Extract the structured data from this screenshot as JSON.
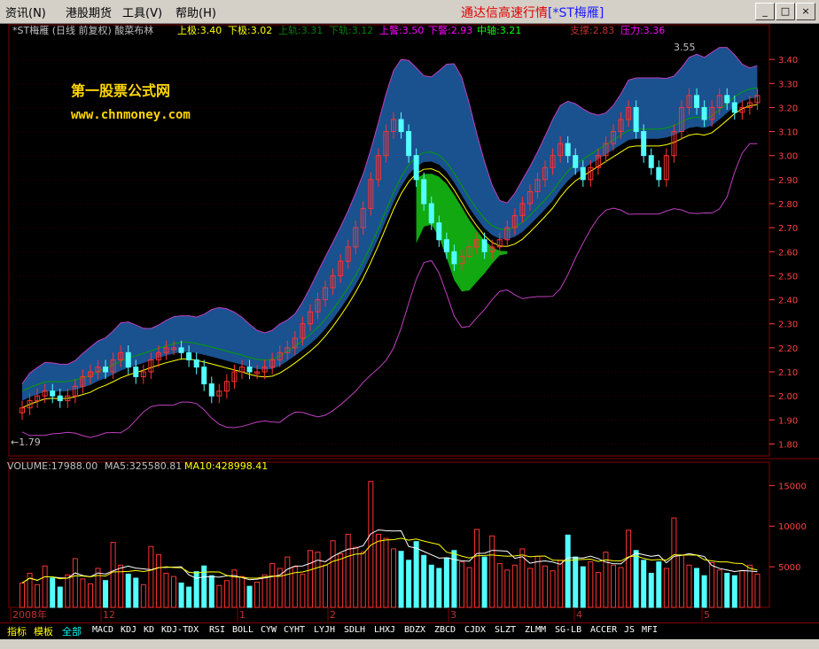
{
  "menu": {
    "items": [
      "资讯(N)",
      "港股期货",
      "工具(V)",
      "帮助(H)"
    ],
    "app_title": "通达信高速行情",
    "window_title": "[*ST梅雁]",
    "win_buttons": [
      "_",
      "□",
      "×"
    ]
  },
  "header": {
    "stock_name": "*ST梅雁 (日线 前复权) 酸菜布林",
    "indicators": [
      {
        "label": "上极:3.40",
        "color": "#ffff00"
      },
      {
        "label": "下极:3.02",
        "color": "#ffff00"
      },
      {
        "label": "上轨:3.31",
        "color": "#008000"
      },
      {
        "label": "下轨:3.12",
        "color": "#008000"
      },
      {
        "label": "上警:3.50",
        "color": "#ff00ff"
      },
      {
        "label": "下警:2.93",
        "color": "#ff00ff"
      },
      {
        "label": "中轴:3.21",
        "color": "#00ff00"
      },
      {
        "label": "支撑:2.83",
        "color": "#c03030"
      },
      {
        "label": "压力:3.36",
        "color": "#ff00ff"
      }
    ]
  },
  "watermark": {
    "line1": "第一股票公式网",
    "line2": "www.chnmoney.com"
  },
  "annotations": {
    "high": "3.55",
    "low": "←1.79"
  },
  "price_axis": [
    "3.40",
    "3.30",
    "3.20",
    "3.10",
    "3.00",
    "2.90",
    "2.80",
    "2.70",
    "2.60",
    "2.50",
    "2.40",
    "2.30",
    "2.20",
    "2.10",
    "2.00",
    "1.90",
    "1.80"
  ],
  "volume_header": {
    "vol": "VOLUME:17988.00",
    "ma5": "MA5:325580.81",
    "ma10": "MA10:428998.41"
  },
  "volume_axis": [
    "15000",
    "10000",
    "5000"
  ],
  "date_axis": [
    "2008年",
    "12",
    "1",
    "2",
    "3",
    "4",
    "5"
  ],
  "tabs": {
    "categories": [
      "指标",
      "模板",
      "全部"
    ],
    "items": [
      "MACD",
      "KDJ",
      "KD",
      "KDJ-TDX",
      "RSI",
      "BOLL",
      "CYW",
      "CYHT",
      "LYJH",
      "SDLH",
      "LHXJ",
      "BDZX",
      "ZBCD",
      "CJDX",
      "SLZT",
      "ZLMM",
      "SG-LB",
      "ACCER",
      "JS",
      "MFI"
    ]
  },
  "chart_data": {
    "type": "candlestick",
    "title": "*ST梅雁 (日线 前复权) 酸菜布林",
    "price_range": [
      1.75,
      3.5
    ],
    "volume_range": [
      0,
      17000
    ],
    "x_labels": [
      "2008年",
      "12",
      "1",
      "2",
      "3",
      "4",
      "5"
    ],
    "high_mark": 3.55,
    "low_mark": 1.79,
    "closes": [
      1.95,
      1.98,
      2.0,
      2.02,
      2.0,
      1.98,
      2.0,
      2.04,
      2.08,
      2.1,
      2.12,
      2.1,
      2.15,
      2.18,
      2.12,
      2.08,
      2.1,
      2.15,
      2.18,
      2.2,
      2.2,
      2.18,
      2.15,
      2.12,
      2.05,
      2.0,
      2.02,
      2.06,
      2.1,
      2.12,
      2.1,
      2.1,
      2.12,
      2.15,
      2.18,
      2.2,
      2.24,
      2.3,
      2.35,
      2.4,
      2.45,
      2.5,
      2.56,
      2.62,
      2.7,
      2.78,
      2.9,
      3.0,
      3.1,
      3.15,
      3.1,
      3.0,
      2.9,
      2.8,
      2.72,
      2.65,
      2.6,
      2.55,
      2.58,
      2.62,
      2.65,
      2.6,
      2.62,
      2.65,
      2.7,
      2.75,
      2.8,
      2.85,
      2.9,
      2.95,
      3.0,
      3.05,
      3.0,
      2.95,
      2.9,
      2.95,
      3.0,
      3.05,
      3.1,
      3.15,
      3.2,
      3.1,
      3.0,
      2.95,
      2.9,
      3.0,
      3.1,
      3.2,
      3.25,
      3.2,
      3.15,
      3.2,
      3.25,
      3.22,
      3.18,
      3.2,
      3.22,
      3.25
    ],
    "volumes": [
      3000,
      4200,
      2800,
      5100,
      3600,
      2500,
      4000,
      6000,
      3500,
      2900,
      4800,
      3300,
      8000,
      5200,
      4100,
      3600,
      2800,
      7500,
      6500,
      4200,
      3800,
      3000,
      2500,
      4400,
      5100,
      3900,
      2700,
      3300,
      4600,
      3800,
      2600,
      3100,
      4000,
      5400,
      4800,
      6200,
      5000,
      4100,
      7000,
      6800,
      5200,
      8200,
      6600,
      9000,
      7400,
      6800,
      15500,
      9000,
      8500,
      7200,
      6900,
      5800,
      8100,
      6400,
      5200,
      4800,
      6100,
      7000,
      5600,
      4900,
      9600,
      6200,
      8800,
      5400,
      4600,
      5200,
      7200,
      4800,
      6300,
      5100,
      4500,
      5800,
      8900,
      6200,
      5000,
      5600,
      4300,
      6800,
      5200,
      4900,
      9500,
      7000,
      5800,
      4200,
      5600,
      4800,
      11000,
      6400,
      5200,
      4800,
      3900,
      5500,
      4600,
      4200,
      3900,
      4500,
      5200,
      4100
    ],
    "volume_ma5_label": 325580.81,
    "volume_ma10_label": 428998.41
  },
  "colors": {
    "up": "#ff3333",
    "down": "#54ffff",
    "band": "#1f5fa8",
    "green_band": "#11a811",
    "grid": "#800000"
  }
}
